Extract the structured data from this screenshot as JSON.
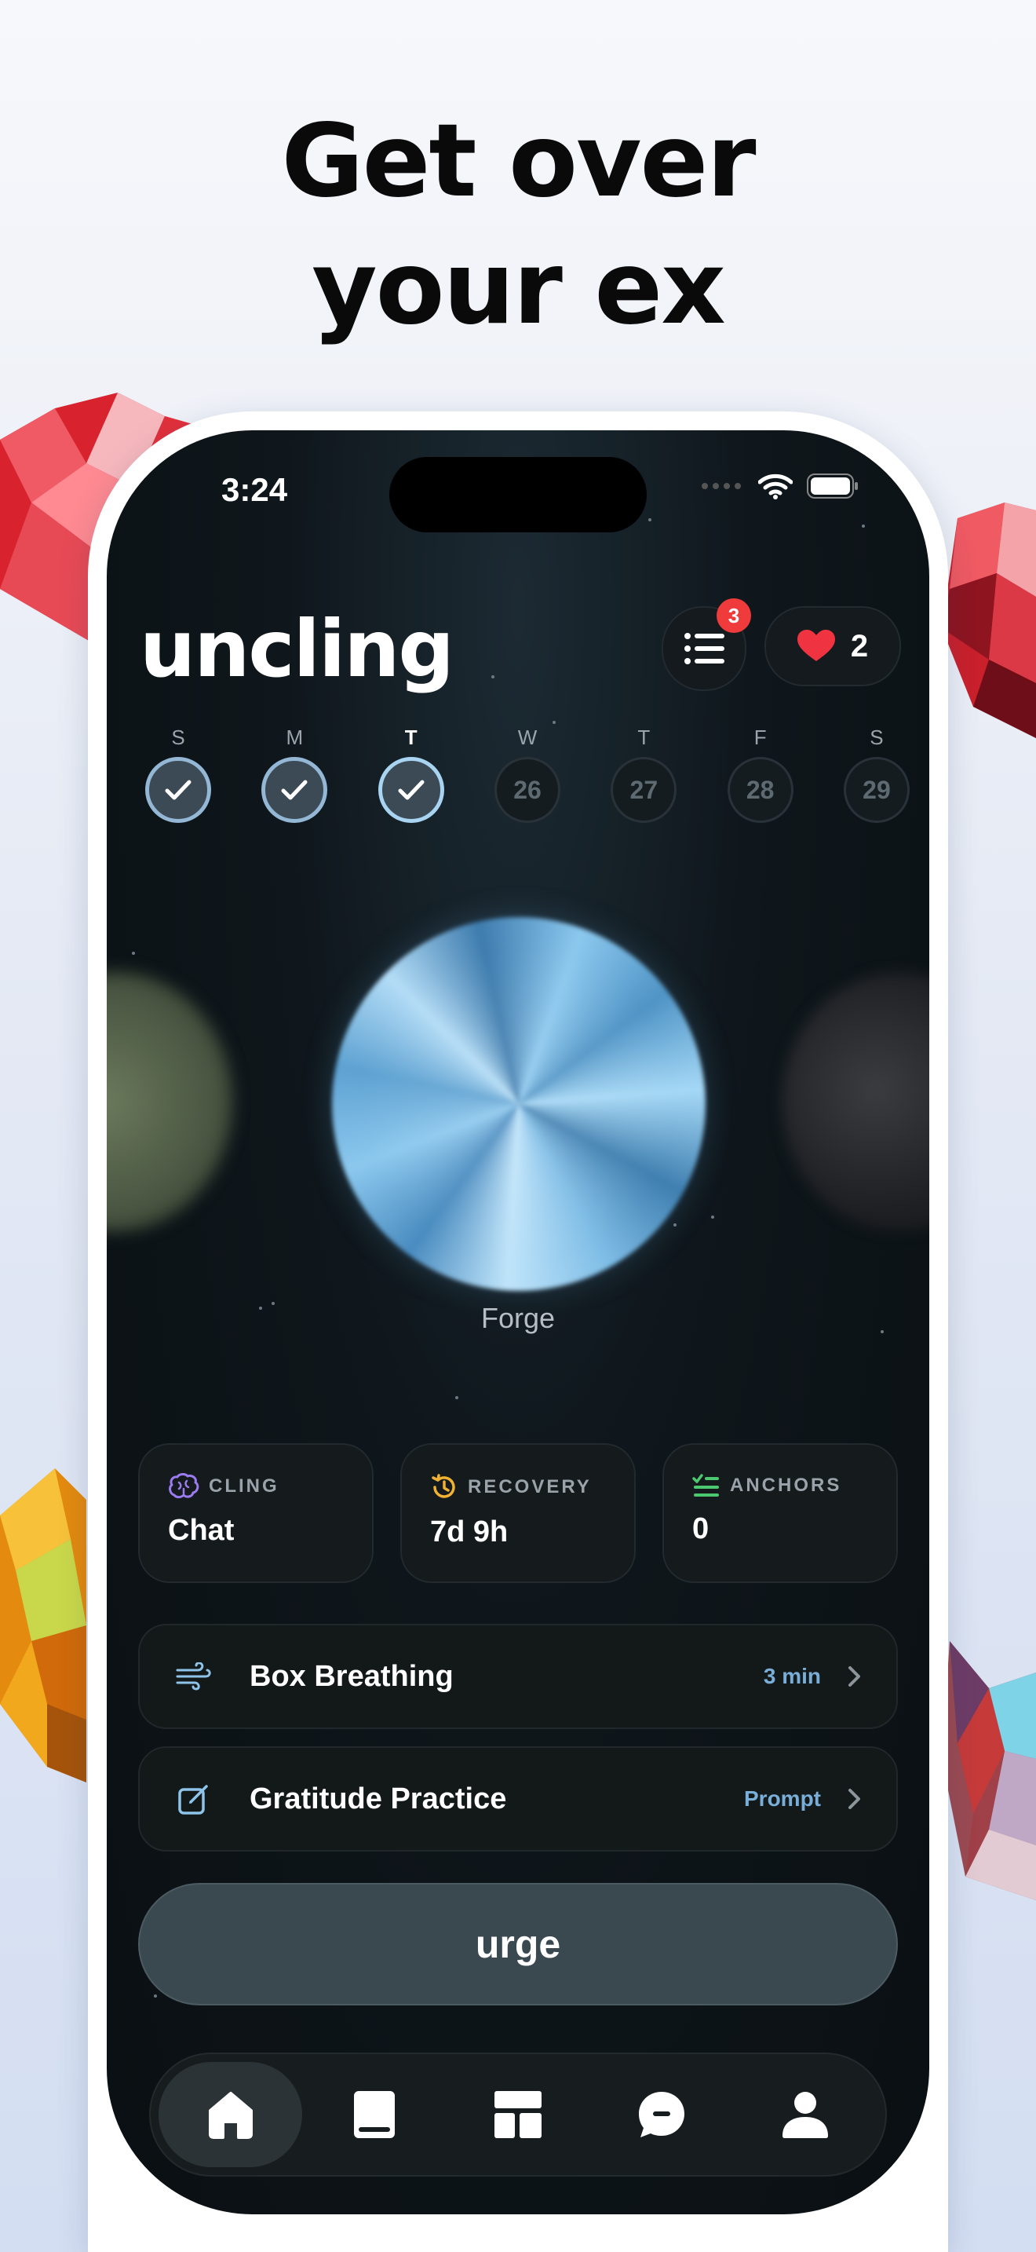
{
  "headline": {
    "line1": "Get over",
    "line2": "your ex"
  },
  "status_bar": {
    "time": "3:24"
  },
  "app": {
    "logo": "uncling",
    "menu_badge": "3",
    "hearts_count": "2"
  },
  "week": [
    {
      "letter": "S",
      "state": "done",
      "date": ""
    },
    {
      "letter": "M",
      "state": "done",
      "date": ""
    },
    {
      "letter": "T",
      "state": "done-today",
      "date": ""
    },
    {
      "letter": "W",
      "state": "future",
      "date": "26"
    },
    {
      "letter": "T",
      "state": "future",
      "date": "27"
    },
    {
      "letter": "F",
      "state": "future",
      "date": "28"
    },
    {
      "letter": "S",
      "state": "future",
      "date": "29"
    }
  ],
  "orb": {
    "label": "Forge"
  },
  "stats": [
    {
      "title": "CLING",
      "value": "Chat",
      "icon": "brain-icon",
      "color": "#9b7cf0"
    },
    {
      "title": "RECOVERY",
      "value": "7d 9h",
      "icon": "history-icon",
      "color": "#f0b232"
    },
    {
      "title": "ANCHORS",
      "value": "0",
      "icon": "checklist-icon",
      "color": "#4cc870"
    }
  ],
  "activities": [
    {
      "title": "Box Breathing",
      "meta": "3 min",
      "icon": "wind-icon"
    },
    {
      "title": "Gratitude Practice",
      "meta": "Prompt",
      "icon": "edit-icon"
    }
  ],
  "urge_button": {
    "label": "urge"
  },
  "tabs": [
    {
      "icon": "home-icon",
      "active": true
    },
    {
      "icon": "book-icon",
      "active": false
    },
    {
      "icon": "dashboard-icon",
      "active": false
    },
    {
      "icon": "chat-icon",
      "active": false
    },
    {
      "icon": "profile-icon",
      "active": false
    }
  ],
  "colors": {
    "accent_blue": "#78aed8",
    "badge_red": "#ef3b3b",
    "heart_red": "#ef3340"
  }
}
